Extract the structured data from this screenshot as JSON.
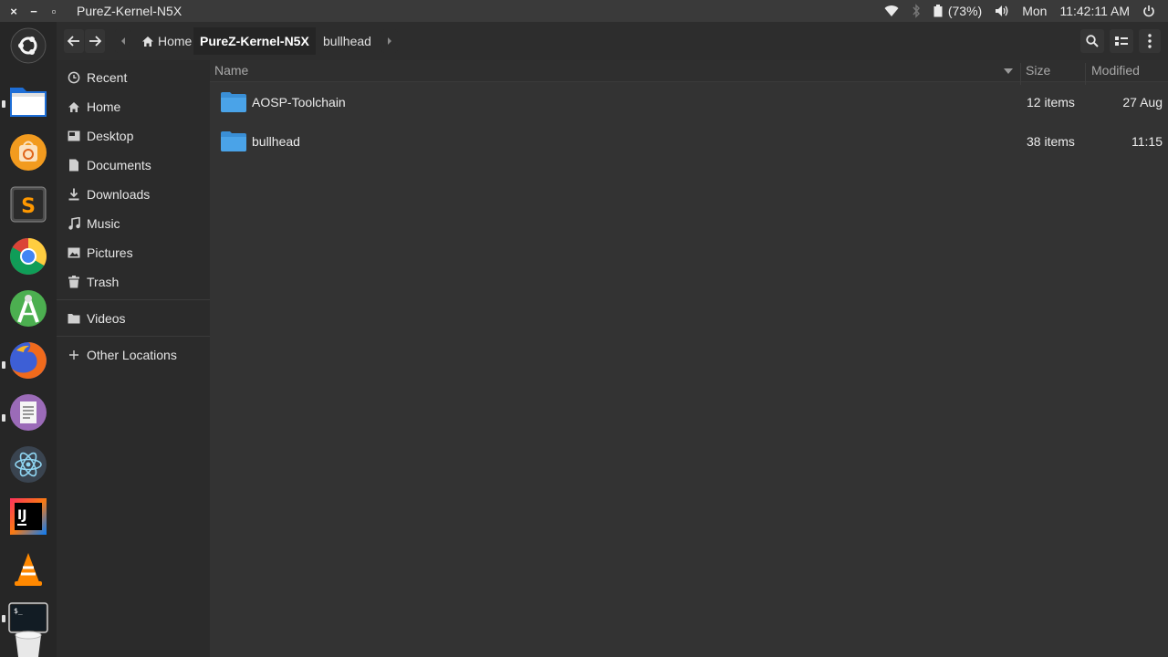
{
  "window": {
    "title": "PureZ-Kernel-N5X",
    "controls": {
      "close": "×",
      "minimize": "−",
      "maximize": "▫"
    }
  },
  "tray": {
    "wifi_icon": "wifi-icon",
    "bluetooth_icon": "bluetooth-icon",
    "battery_percent": "(73%)",
    "volume_icon": "volume-icon",
    "day": "Mon",
    "time": "11:42:11 AM",
    "power_icon": "power-icon"
  },
  "launcher": {
    "apps": [
      "ubuntu-logo-icon",
      "files-icon",
      "ubuntu-software-icon",
      "sublime-text-icon",
      "chrome-icon",
      "android-studio-icon",
      "firefox-icon",
      "text-editor-icon",
      "atom-icon",
      "intellij-icon",
      "vlc-icon",
      "terminal-icon",
      "trash-bin-icon"
    ]
  },
  "breadcrumb": {
    "items": [
      "Home",
      "PureZ-Kernel-N5X",
      "bullhead"
    ]
  },
  "sidebar": {
    "items": [
      {
        "label": "Recent",
        "icon": "clock-icon"
      },
      {
        "label": "Home",
        "icon": "home-icon"
      },
      {
        "label": "Desktop",
        "icon": "desktop-icon"
      },
      {
        "label": "Documents",
        "icon": "document-icon"
      },
      {
        "label": "Downloads",
        "icon": "download-icon"
      },
      {
        "label": "Music",
        "icon": "music-icon"
      },
      {
        "label": "Pictures",
        "icon": "picture-icon"
      },
      {
        "label": "Trash",
        "icon": "trash-icon"
      },
      {
        "label": "Videos",
        "icon": "folder-icon"
      },
      {
        "label": "Other Locations",
        "icon": "plus-icon"
      }
    ]
  },
  "columns": {
    "name": "Name",
    "size": "Size",
    "modified": "Modified"
  },
  "files": [
    {
      "name": "AOSP-Toolchain",
      "size": "12 items",
      "modified": "27 Aug"
    },
    {
      "name": "bullhead",
      "size": "38 items",
      "modified": "11:15"
    }
  ],
  "colors": {
    "folder": "#4aa3e8",
    "panel": "#3a3a3a",
    "sidebar": "#2b2b2b",
    "content": "#333333"
  }
}
